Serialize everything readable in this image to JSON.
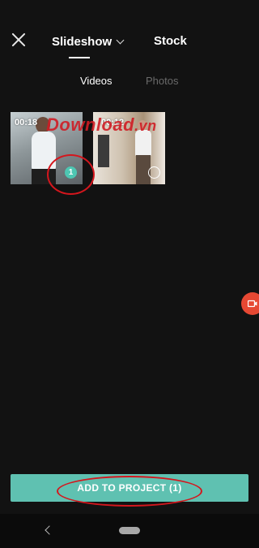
{
  "header": {
    "tab_main": "Slideshow",
    "tab_stock": "Stock"
  },
  "subtabs": {
    "videos": "Videos",
    "photos": "Photos"
  },
  "media": [
    {
      "duration": "00:18",
      "selected_index": "1"
    },
    {
      "duration": "00:12"
    }
  ],
  "watermark": {
    "text": "Download",
    "suffix": ".vn"
  },
  "footer": {
    "add_button": "ADD TO PROJECT (1)"
  },
  "colors": {
    "accent": "#5fc1b1",
    "annotation": "#d4161d",
    "background": "#121212"
  },
  "icons": [
    "close-icon",
    "chevron-down-icon",
    "camera-icon",
    "back-icon",
    "home-icon"
  ]
}
